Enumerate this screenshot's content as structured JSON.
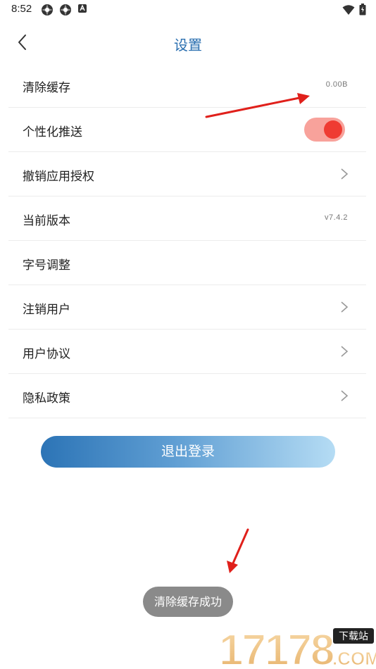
{
  "status_bar": {
    "time": "8:52"
  },
  "header": {
    "title": "设置"
  },
  "settings": {
    "rows": [
      {
        "label": "清除缓存",
        "value": "0.00B"
      },
      {
        "label": "个性化推送",
        "toggle_on": true
      },
      {
        "label": "撤销应用授权"
      },
      {
        "label": "当前版本",
        "value": "v7.4.2"
      },
      {
        "label": "字号调整"
      },
      {
        "label": "注销用户"
      },
      {
        "label": "用户协议"
      },
      {
        "label": "隐私政策"
      }
    ]
  },
  "logout_label": "退出登录",
  "toast_text": "清除缓存成功",
  "watermark": {
    "brand": "17178",
    "tag": "下载站",
    "domain": ".COM"
  },
  "colors": {
    "title": "#2a6fb0",
    "toggle_track": "#f8a29b",
    "toggle_knob": "#ef3b32",
    "button_gradient_start": "#2c74b6",
    "button_gradient_end": "#b5dcf4",
    "toast_bg": "#8a8a8a",
    "annotation_arrow": "#e0201b"
  },
  "icons": {
    "status_left": [
      "app-icon",
      "app-icon",
      "notification-icon"
    ],
    "status_right": [
      "wifi-icon",
      "battery-icon"
    ],
    "back": "back-arrow-icon",
    "row_chevron": "chevron-right-icon"
  }
}
